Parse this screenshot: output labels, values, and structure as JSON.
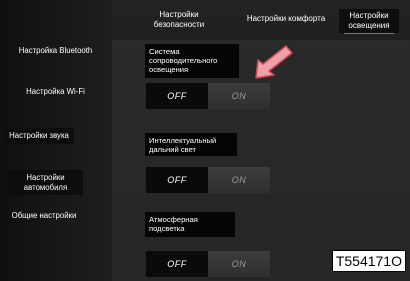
{
  "tabs": [
    {
      "label": "Настройки безопасности",
      "active": false
    },
    {
      "label": "Настройки комфорта",
      "active": false
    },
    {
      "label": "Настройки освещения",
      "active": true
    }
  ],
  "sidebar": {
    "items": [
      {
        "label": "Настройка Bluetooth"
      },
      {
        "label": "Настройка Wi-Fi"
      },
      {
        "label": "Настройки звука"
      },
      {
        "label": "Настройки автомобиля"
      },
      {
        "label": "Общие настройки"
      }
    ]
  },
  "settings": [
    {
      "label": "Система сопроводительного освещения",
      "off_label": "OFF",
      "on_label": "ON",
      "selected": "OFF"
    },
    {
      "label": "Интеллектуальный дальний свет",
      "off_label": "OFF",
      "on_label": "ON",
      "selected": "OFF"
    },
    {
      "label": "Атмосферная подсветка",
      "off_label": "OFF",
      "on_label": "ON",
      "selected": "OFF"
    }
  ],
  "figure_code": "T554171O",
  "colors": {
    "accent_underline": "#e14b55",
    "arrow": "#f0a0a8"
  },
  "icons": {
    "pointer_arrow": "arrow-pointer-icon"
  }
}
